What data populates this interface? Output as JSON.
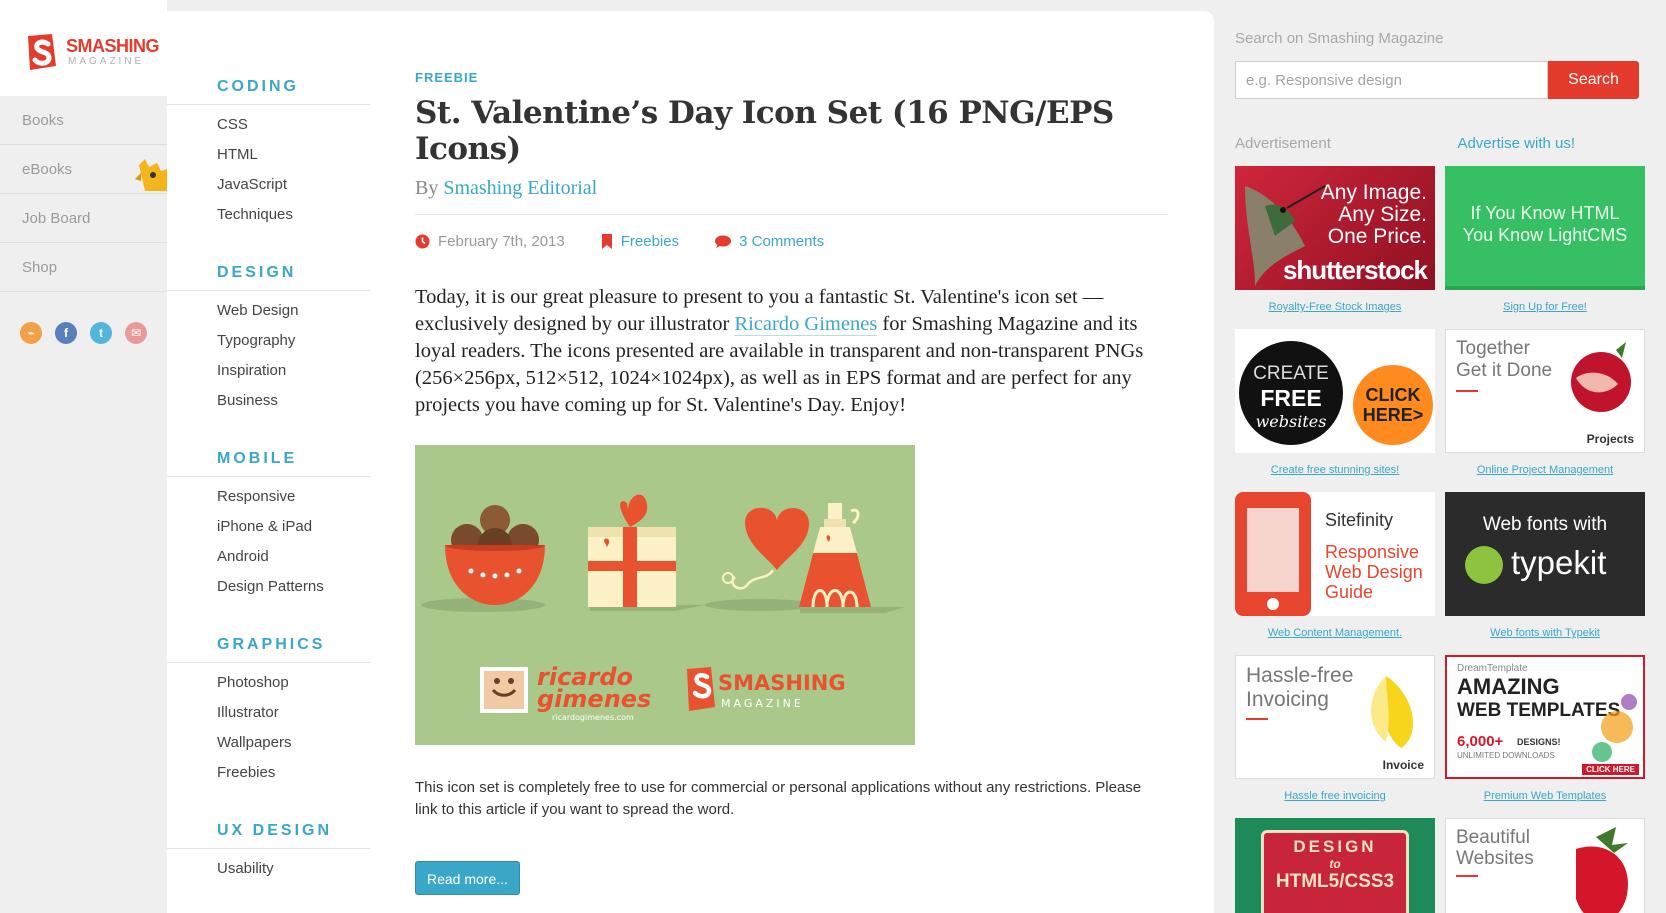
{
  "brand": {
    "name": "SMASHING",
    "sub": "MAGAZINE"
  },
  "leftnav": {
    "items": [
      {
        "label": "Books"
      },
      {
        "label": "eBooks"
      },
      {
        "label": "Job Board"
      },
      {
        "label": "Shop"
      }
    ],
    "social": [
      "rss-icon",
      "facebook-icon",
      "twitter-icon",
      "email-icon"
    ]
  },
  "categories": [
    {
      "heading": "CODING",
      "items": [
        "CSS",
        "HTML",
        "JavaScript",
        "Techniques"
      ]
    },
    {
      "heading": "DESIGN",
      "items": [
        "Web Design",
        "Typography",
        "Inspiration",
        "Business"
      ]
    },
    {
      "heading": "MOBILE",
      "items": [
        "Responsive",
        "iPhone & iPad",
        "Android",
        "Design Patterns"
      ]
    },
    {
      "heading": "GRAPHICS",
      "items": [
        "Photoshop",
        "Illustrator",
        "Wallpapers",
        "Freebies"
      ]
    },
    {
      "heading": "UX DESIGN",
      "items": [
        "Usability"
      ]
    }
  ],
  "article": {
    "category": "FREEBIE",
    "title": "St. Valentine’s Day Icon Set (16 PNG/EPS Icons)",
    "by": "By",
    "author": "Smashing Editorial",
    "date": "February 7th, 2013",
    "section": "Freebies",
    "comments": "3 Comments",
    "intro_a": "Today, it is our great pleasure to present to you a fantastic St. Valentine's icon set — exclusively designed by our illustrator ",
    "intro_link": "Ricardo Gimenes",
    "intro_b": " for Smashing Magazine and its loyal readers. The icons presented are available in transparent and non-transparent PNGs (256×256px, 512×512, 1024×1024px), as well as in EPS format and are perfect for any projects you have coming up for St. Valentine's Day. Enjoy!",
    "hero": {
      "brand1": "ricardo",
      "brand2": "gimenes",
      "brand3": "ricardogimenes.com",
      "brand4": "SMASHING",
      "brand5": "MAGAZINE"
    },
    "body": "This icon set is completely free to use for commercial or personal applications without any restrictions. Please link to this article if you want to spread the word.",
    "readmore": "Read more..."
  },
  "sidebar": {
    "search_label": "Search on Smashing Magazine",
    "search_placeholder": "e.g. Responsive design",
    "search_button": "Search",
    "ad_label": "Advertisement",
    "ad_link": "Advertise with us!",
    "ads": [
      {
        "caption": "Royalty-Free Stock Images",
        "line1": "Any Image.",
        "line2": "Any Size.",
        "line3": "One Price.",
        "brand": "shutterstock"
      },
      {
        "caption": "Sign Up for Free!",
        "line1": "If You Know HTML",
        "line2": "You Know LightCMS"
      },
      {
        "caption": "Create free stunning sites!",
        "line1": "CREATE",
        "line2": "FREE",
        "line3": "websites",
        "cta1": "CLICK",
        "cta2": "HERE>"
      },
      {
        "caption": "Online Project Management",
        "line1": "Together",
        "line2": "Get it Done",
        "brand": "Projects"
      },
      {
        "caption": "Web Content Management.",
        "brand": "Sitefinity",
        "line1": "Responsive",
        "line2": "Web Design",
        "line3": "Guide"
      },
      {
        "caption": "Web fonts with Typekit",
        "line1": "Web fonts with",
        "brand": "typekit"
      },
      {
        "caption": "Hassle free invoicing",
        "line1": "Hassle-free",
        "line2": "Invoicing",
        "brand": "Invoice"
      },
      {
        "caption": "Premium Web Templates",
        "line0": "DreamTemplate",
        "line1": "AMAZING",
        "line2": "WEB TEMPLATES",
        "line3": "6,000+",
        "line4": "DESIGNS!",
        "line5": "UNLIMITED DOWNLOADS",
        "cta": "CLICK HERE"
      },
      {
        "caption": "",
        "line1": "DESIGN",
        "line2": "to",
        "line3": "HTML5/CSS3"
      },
      {
        "caption": "",
        "line1": "Beautiful",
        "line2": "Websites"
      }
    ]
  },
  "colors": {
    "accent": "#3aa6c8",
    "brand": "#e53b2c"
  }
}
